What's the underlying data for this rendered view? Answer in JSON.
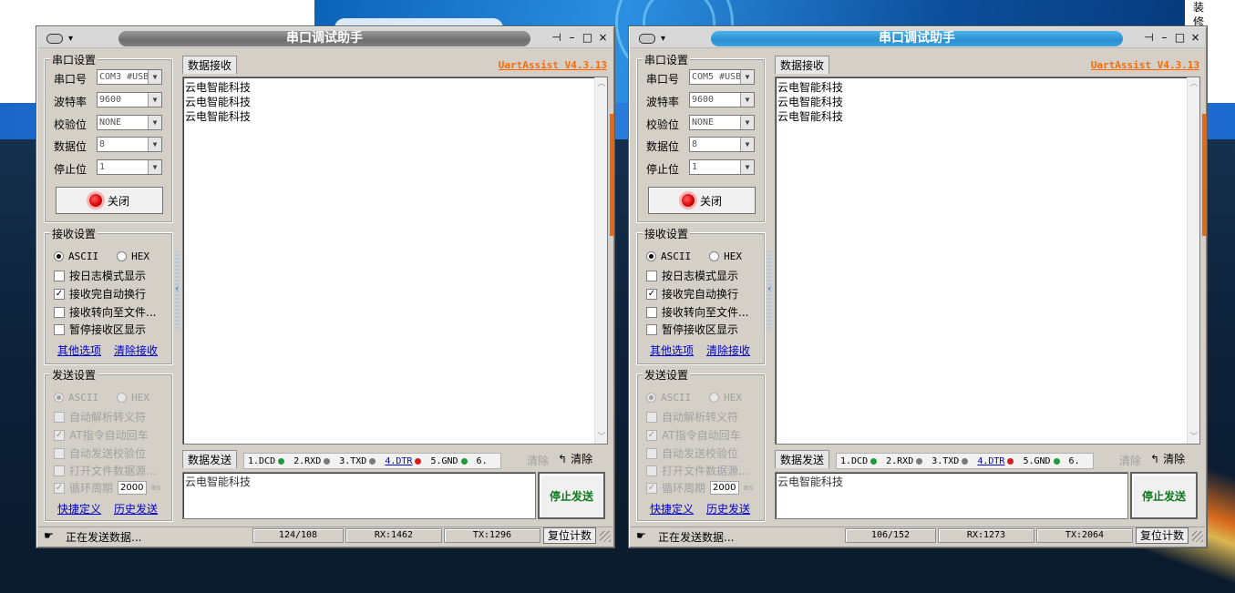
{
  "desktop": {
    "side_text": [
      "装",
      "修"
    ]
  },
  "windows": [
    {
      "title": "串口调试助手",
      "version": "UartAssist V4.3.13",
      "serial": {
        "group_title": "串口设置",
        "labels": {
          "port": "串口号",
          "baud": "波特率",
          "parity": "校验位",
          "databits": "数据位",
          "stopbits": "停止位"
        },
        "values": {
          "port": "COM3 #USB",
          "baud": "9600",
          "parity": "NONE",
          "databits": "8",
          "stopbits": "1"
        },
        "close_label": "关闭"
      },
      "recv_settings": {
        "group_title": "接收设置",
        "ascii": "ASCII",
        "hex": "HEX",
        "opt_log": "按日志模式显示",
        "opt_autowrap": "接收完自动换行",
        "opt_tofile": "接收转向至文件...",
        "opt_pause": "暂停接收区显示",
        "link_other": "其他选项",
        "link_clear": "清除接收"
      },
      "send_settings": {
        "group_title": "发送设置",
        "ascii": "ASCII",
        "hex": "HEX",
        "opt_escape": "自动解析转义符",
        "opt_at": "AT指令自动回车",
        "opt_checksum": "自动发送校验位",
        "opt_file": "打开文件数据源...",
        "opt_cycle": "循环周期",
        "period": "2000",
        "unit": "ms",
        "link_shortcut": "快捷定义",
        "link_history": "历史发送"
      },
      "recv_tab": "数据接收",
      "recv_lines": [
        "云电智能科技",
        "云电智能科技",
        "云电智能科技"
      ],
      "send_tab": "数据发送",
      "pins": {
        "dcd": "1.DCD",
        "rxd": "2.RXD",
        "txd": "3.TXD",
        "dtr": "4.DTR",
        "gnd": "5.GND",
        "more": "6."
      },
      "clear_gray": "清除",
      "clear_label": "清除",
      "send_text": "云电智能科技",
      "stop_label": "停止发送",
      "status": {
        "text": "正在发送数据...",
        "count": "124/108",
        "rx": "RX:1462",
        "tx": "TX:1296",
        "reset": "复位计数"
      }
    },
    {
      "title": "串口调试助手",
      "version": "UartAssist V4.3.13",
      "serial": {
        "group_title": "串口设置",
        "labels": {
          "port": "串口号",
          "baud": "波特率",
          "parity": "校验位",
          "databits": "数据位",
          "stopbits": "停止位"
        },
        "values": {
          "port": "COM5 #USB",
          "baud": "9600",
          "parity": "NONE",
          "databits": "8",
          "stopbits": "1"
        },
        "close_label": "关闭"
      },
      "recv_settings": {
        "group_title": "接收设置",
        "ascii": "ASCII",
        "hex": "HEX",
        "opt_log": "按日志模式显示",
        "opt_autowrap": "接收完自动换行",
        "opt_tofile": "接收转向至文件...",
        "opt_pause": "暂停接收区显示",
        "link_other": "其他选项",
        "link_clear": "清除接收"
      },
      "send_settings": {
        "group_title": "发送设置",
        "ascii": "ASCII",
        "hex": "HEX",
        "opt_escape": "自动解析转义符",
        "opt_at": "AT指令自动回车",
        "opt_checksum": "自动发送校验位",
        "opt_file": "打开文件数据源...",
        "opt_cycle": "循环周期",
        "period": "2000",
        "unit": "ms",
        "link_shortcut": "快捷定义",
        "link_history": "历史发送"
      },
      "recv_tab": "数据接收",
      "recv_lines": [
        "云电智能科技",
        "云电智能科技",
        "云电智能科技"
      ],
      "send_tab": "数据发送",
      "pins": {
        "dcd": "1.DCD",
        "rxd": "2.RXD",
        "txd": "3.TXD",
        "dtr": "4.DTR",
        "gnd": "5.GND",
        "more": "6."
      },
      "clear_gray": "清除",
      "clear_label": "清除",
      "send_text": "云电智能科技",
      "stop_label": "停止发送",
      "status": {
        "text": "正在发送数据...",
        "count": "106/152",
        "rx": "RX:1273",
        "tx": "TX:2064",
        "reset": "复位计数"
      }
    }
  ],
  "colors": {
    "version": "#ff6a00",
    "link": "#0000cc",
    "stop_text": "#0a7a1a",
    "led": "#d40000"
  }
}
